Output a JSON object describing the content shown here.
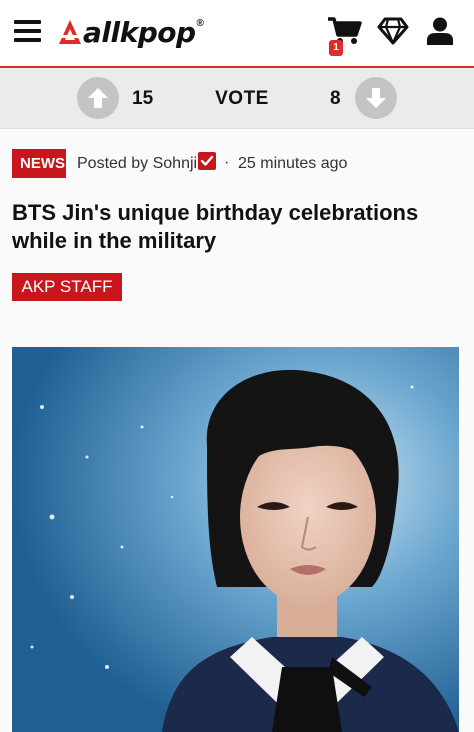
{
  "header": {
    "logo_text": "allkpop",
    "logo_mark": "®",
    "cart_count": "1",
    "menu_icon": "hamburger-menu-icon",
    "cart_icon": "shopping-cart-icon",
    "vip_icon": "diamond-icon",
    "account_icon": "user-icon",
    "accent_color": "#e02b2b"
  },
  "vote": {
    "upvotes": "15",
    "label": "VOTE",
    "downvotes": "8"
  },
  "article": {
    "category": "NEWS",
    "posted_by": "Posted by Sohnji",
    "separator": "·",
    "time_ago": "25 minutes ago",
    "title": "BTS Jin's unique birthday celebrations while in the military",
    "staff_tag": "AKP STAFF",
    "badge_color": "#c8161d"
  }
}
